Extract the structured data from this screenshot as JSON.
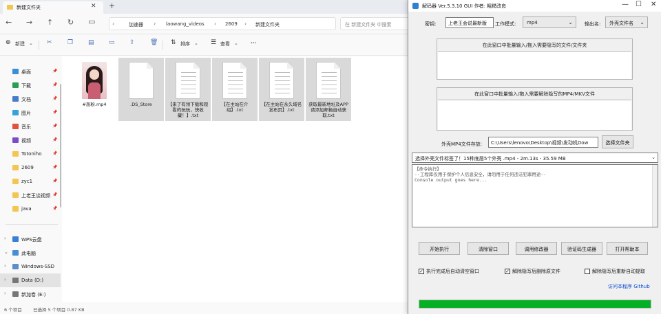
{
  "explorer": {
    "tab_title": "新建文件夹",
    "breadcrumbs": [
      "加速器",
      "laowang_videos",
      "2609",
      "新建文件夹"
    ],
    "search_placeholder": "在 新建文件夹 中搜索",
    "toolbar": {
      "new_label": "新建",
      "sort_label": "排序",
      "view_label": "查看",
      "more_label": "···"
    },
    "nav_items": [
      {
        "label": "桌面",
        "icon": "desktop-icon",
        "color": "#3a8fd6"
      },
      {
        "label": "下载",
        "icon": "download-icon",
        "color": "#2a9d55"
      },
      {
        "label": "文档",
        "icon": "documents-icon",
        "color": "#4a7bc8"
      },
      {
        "label": "图片",
        "icon": "pictures-icon",
        "color": "#3aa0d8"
      },
      {
        "label": "音乐",
        "icon": "music-icon",
        "color": "#e0533d"
      },
      {
        "label": "视频",
        "icon": "videos-icon",
        "color": "#7a4cc9"
      },
      {
        "label": "Totoniho",
        "icon": "folder-icon",
        "color": "#f3c654"
      },
      {
        "label": "2609",
        "icon": "folder-icon",
        "color": "#f3c654"
      },
      {
        "label": "zyc1",
        "icon": "folder-icon",
        "color": "#f3c654"
      },
      {
        "label": "上老王谈视频",
        "icon": "folder-icon",
        "color": "#f3c654"
      },
      {
        "label": "java",
        "icon": "folder-icon",
        "color": "#f3c654"
      },
      {
        "label": "WPS云盘",
        "icon": "cloud-icon",
        "color": "#3a7fd6"
      },
      {
        "label": "此电脑",
        "icon": "computer-icon",
        "color": "#4a8ed0"
      },
      {
        "label": "Windows-SSD",
        "icon": "drive-icon",
        "color": "#5a8fc8"
      },
      {
        "label": "Data (D:)",
        "icon": "drive-icon",
        "color": "#777777"
      },
      {
        "label": "新加卷 (E:)",
        "icon": "drive-icon",
        "color": "#777777"
      }
    ],
    "files": [
      {
        "name": "#涨粉.mp4",
        "kind": "video",
        "selected": false
      },
      {
        "name": ".DS_Store",
        "kind": "blank",
        "selected": true
      },
      {
        "name": "【来了有领下载和观看的玩玩，快收藏！】.txt",
        "kind": "txt",
        "selected": true
      },
      {
        "name": "【在主站在介绍】.txt",
        "kind": "txt",
        "selected": true
      },
      {
        "name": "【在主站在永久域名发布页】.txt",
        "kind": "txt",
        "selected": true
      },
      {
        "name": "获取最新地址及APP请添加邮箱自动获取.txt",
        "kind": "txt",
        "selected": true
      }
    ],
    "status": {
      "count": "6 个项目",
      "selected": "已选择 5 个项目 0.87 KB"
    }
  },
  "tool": {
    "title": "解码器 Ver.5.3.10 GUI 作者: 粗糙改良",
    "codec_label": "密钥:",
    "codec_value": "上老王会说最新版",
    "mode_label": "工作模式:",
    "mode_value": "mp4",
    "output_label": "输出名:",
    "output_value": "外壳文件名",
    "group1_label": "在此窗口中批量输入/拖入需要隐写的文件/文件夹",
    "group2_label": "在此窗口中批量输入/拖入需要解除隐写的MP4/MKV文件",
    "storage_label": "外壳MP4文件存放:",
    "storage_path": "C:\\Users\\lenovo\\Desktop\\视频\\发动机Dow",
    "choose_btn": "选择文件夹",
    "dropdown_text": "选择外壳文件标签了！15种底层5个外壳 .mp4 - 2m.13s - 35.59 MB",
    "log_lines": [
      "【命令执行】",
      "--工程库仅用于保护个人信息安全，请勿用于任何违法犯罪用途--",
      "Console output goes here..."
    ],
    "buttons": [
      "开始执行",
      "清除窗口",
      "调用修改器",
      "验证码生成器",
      "打开帮助本"
    ],
    "checks": [
      {
        "label": "执行完成后自动清空窗口",
        "checked": true
      },
      {
        "label": "解除隐写后删除原文件",
        "checked": true
      },
      {
        "label": "解除隐写后重新自动提取",
        "checked": false
      }
    ],
    "link": "访问本程序 Github",
    "progress_percent": 100,
    "progress_color": "#06b025"
  }
}
